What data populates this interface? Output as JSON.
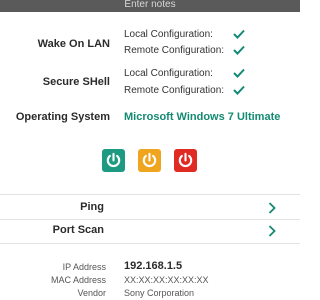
{
  "notes": {
    "placeholder": "Enter notes"
  },
  "wol": {
    "label": "Wake On LAN",
    "local": "Local Configuration:",
    "remote": "Remote Configuration:"
  },
  "ssh": {
    "label": "Secure SHell",
    "local": "Local Configuration:",
    "remote": "Remote Configuration:"
  },
  "os": {
    "label": "Operating System",
    "value": "Microsoft Windows 7 Ultimate"
  },
  "actions": {
    "colors": {
      "wake": "#1e9a82",
      "reboot": "#f0a51e",
      "shutdown": "#e02a24"
    },
    "icons": [
      "power-icon",
      "power-icon",
      "power-icon"
    ]
  },
  "menu": {
    "ping": "Ping",
    "port_scan": "Port Scan"
  },
  "info": {
    "ip_label": "IP Address",
    "ip_value": "192.168.1.5",
    "mac_label": "MAC Address",
    "mac_value": "XX:XX:XX:XX:XX:XX",
    "vendor_label": "Vendor",
    "vendor_value": "Sony Corporation"
  }
}
